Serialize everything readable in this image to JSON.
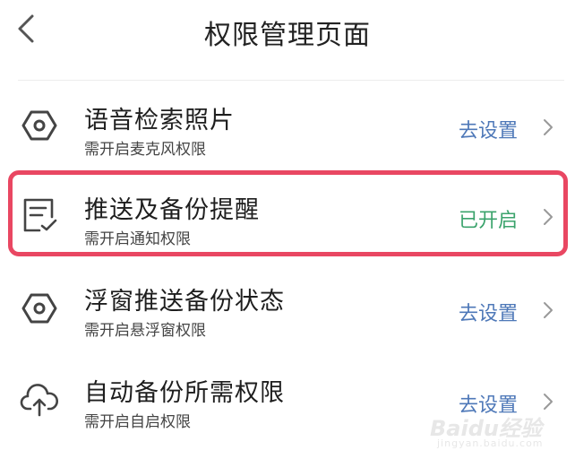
{
  "header": {
    "title": "权限管理页面",
    "back_icon": "chevron-left-icon"
  },
  "items": [
    {
      "title": "语音检索照片",
      "subtitle": "需开启麦克风权限",
      "action": "去设置",
      "icon": "hexagon-gear-icon"
    },
    {
      "title": "推送及备份提醒",
      "subtitle": "需开启通知权限",
      "action": "已开启",
      "icon": "document-check-icon"
    },
    {
      "title": "浮窗推送备份状态",
      "subtitle": "需开启悬浮窗权限",
      "action": "去设置",
      "icon": "hexagon-gear-icon"
    },
    {
      "title": "自动备份所需权限",
      "subtitle": "需开启自启权限",
      "action": "去设置",
      "icon": "cloud-upload-icon"
    }
  ],
  "colors": {
    "action_link": "#4e78b8",
    "action_enabled": "#3ba36c",
    "highlight_border": "#e94762"
  },
  "watermark": {
    "brand": "Baidu经验",
    "url": "jingyan.baidu.com"
  }
}
